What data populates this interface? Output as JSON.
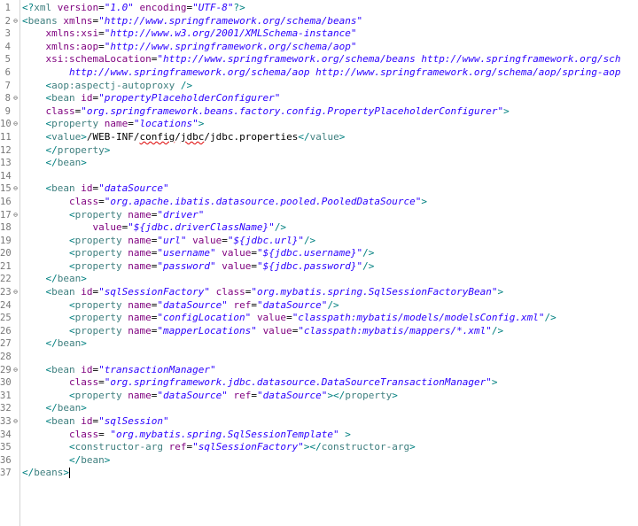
{
  "lines": [
    {
      "n": "1",
      "fold": "",
      "tokens": [
        [
          "pun",
          "<?"
        ],
        [
          "tag",
          "xml"
        ],
        [
          "txt",
          " "
        ],
        [
          "attr",
          "version"
        ],
        [
          "txt",
          "="
        ],
        [
          "val",
          "\"1.0\""
        ],
        [
          "txt",
          " "
        ],
        [
          "attr",
          "encoding"
        ],
        [
          "txt",
          "="
        ],
        [
          "val",
          "\"UTF-8\""
        ],
        [
          "pun",
          "?>"
        ]
      ]
    },
    {
      "n": "2",
      "fold": "⊖",
      "tokens": [
        [
          "pun",
          "<"
        ],
        [
          "tag",
          "beans"
        ],
        [
          "txt",
          " "
        ],
        [
          "attr",
          "xmlns"
        ],
        [
          "txt",
          "="
        ],
        [
          "val",
          "\"http://www.springframework.org/schema/beans\""
        ]
      ]
    },
    {
      "n": "3",
      "fold": "",
      "tokens": [
        [
          "txt",
          "    "
        ],
        [
          "attr",
          "xmlns:xsi"
        ],
        [
          "txt",
          "="
        ],
        [
          "val",
          "\"http://www.w3.org/2001/XMLSchema-instance\""
        ]
      ]
    },
    {
      "n": "4",
      "fold": "",
      "tokens": [
        [
          "txt",
          "    "
        ],
        [
          "attr",
          "xmlns:aop"
        ],
        [
          "txt",
          "="
        ],
        [
          "val",
          "\"http://www.springframework.org/schema/aop\""
        ]
      ]
    },
    {
      "n": "5",
      "fold": "",
      "tokens": [
        [
          "txt",
          "    "
        ],
        [
          "attr",
          "xsi:schemaLocation"
        ],
        [
          "txt",
          "="
        ],
        [
          "val",
          "\"http://www.springframework.org/schema/beans http://www.springframework.org/sch"
        ]
      ]
    },
    {
      "n": "6",
      "fold": "",
      "tokens": [
        [
          "val",
          "        http://www.springframework.org/schema/aop http://www.springframework.org/schema/aop/spring-aop"
        ]
      ]
    },
    {
      "n": "7",
      "fold": "",
      "tokens": [
        [
          "txt",
          "    "
        ],
        [
          "pun",
          "<"
        ],
        [
          "tag",
          "aop:aspectj-autoproxy"
        ],
        [
          "txt",
          " "
        ],
        [
          "pun",
          "/>"
        ]
      ]
    },
    {
      "n": "8",
      "fold": "⊖",
      "tokens": [
        [
          "txt",
          "    "
        ],
        [
          "pun",
          "<"
        ],
        [
          "tag",
          "bean"
        ],
        [
          "txt",
          " "
        ],
        [
          "attr",
          "id"
        ],
        [
          "txt",
          "="
        ],
        [
          "val",
          "\"propertyPlaceholderConfigurer\""
        ]
      ]
    },
    {
      "n": "9",
      "fold": "",
      "tokens": [
        [
          "txt",
          "    "
        ],
        [
          "attr",
          "class"
        ],
        [
          "txt",
          "="
        ],
        [
          "val",
          "\"org.springframework.beans.factory.config.PropertyPlaceholderConfigurer\""
        ],
        [
          "pun",
          ">"
        ]
      ]
    },
    {
      "n": "10",
      "fold": "⊖",
      "tokens": [
        [
          "txt",
          "    "
        ],
        [
          "pun",
          "<"
        ],
        [
          "tag",
          "property"
        ],
        [
          "txt",
          " "
        ],
        [
          "attr",
          "name"
        ],
        [
          "txt",
          "="
        ],
        [
          "val",
          "\"locations\""
        ],
        [
          "pun",
          ">"
        ]
      ]
    },
    {
      "n": "11",
      "fold": "",
      "tokens": [
        [
          "txt",
          "    "
        ],
        [
          "pun",
          "<"
        ],
        [
          "tag",
          "value"
        ],
        [
          "pun",
          ">"
        ],
        [
          "txt",
          "/WEB-INF/"
        ],
        [
          "sq",
          "config"
        ],
        [
          "txt",
          "/"
        ],
        [
          "sq",
          "jdbc"
        ],
        [
          "txt",
          "/jdbc.properties"
        ],
        [
          "pun",
          "</"
        ],
        [
          "tag",
          "value"
        ],
        [
          "pun",
          ">"
        ]
      ]
    },
    {
      "n": "12",
      "fold": "",
      "tokens": [
        [
          "txt",
          "    "
        ],
        [
          "pun",
          "</"
        ],
        [
          "tag",
          "property"
        ],
        [
          "pun",
          ">"
        ]
      ]
    },
    {
      "n": "13",
      "fold": "",
      "tokens": [
        [
          "txt",
          "    "
        ],
        [
          "pun",
          "</"
        ],
        [
          "tag",
          "bean"
        ],
        [
          "pun",
          ">"
        ]
      ]
    },
    {
      "n": "14",
      "fold": "",
      "tokens": []
    },
    {
      "n": "15",
      "fold": "⊖",
      "tokens": [
        [
          "txt",
          "    "
        ],
        [
          "pun",
          "<"
        ],
        [
          "tag",
          "bean"
        ],
        [
          "txt",
          " "
        ],
        [
          "attr",
          "id"
        ],
        [
          "txt",
          "="
        ],
        [
          "val",
          "\"dataSource\""
        ]
      ]
    },
    {
      "n": "16",
      "fold": "",
      "tokens": [
        [
          "txt",
          "        "
        ],
        [
          "attr",
          "class"
        ],
        [
          "txt",
          "="
        ],
        [
          "val",
          "\"org.apache.ibatis.datasource.pooled.PooledDataSource\""
        ],
        [
          "pun",
          ">"
        ]
      ]
    },
    {
      "n": "17",
      "fold": "⊖",
      "tokens": [
        [
          "txt",
          "        "
        ],
        [
          "pun",
          "<"
        ],
        [
          "tag",
          "property"
        ],
        [
          "txt",
          " "
        ],
        [
          "attr",
          "name"
        ],
        [
          "txt",
          "="
        ],
        [
          "val",
          "\"driver\""
        ]
      ]
    },
    {
      "n": "18",
      "fold": "",
      "tokens": [
        [
          "txt",
          "            "
        ],
        [
          "attr",
          "value"
        ],
        [
          "txt",
          "="
        ],
        [
          "val",
          "\"${jdbc.driverClassName}\""
        ],
        [
          "pun",
          "/>"
        ]
      ]
    },
    {
      "n": "19",
      "fold": "",
      "tokens": [
        [
          "txt",
          "        "
        ],
        [
          "pun",
          "<"
        ],
        [
          "tag",
          "property"
        ],
        [
          "txt",
          " "
        ],
        [
          "attr",
          "name"
        ],
        [
          "txt",
          "="
        ],
        [
          "val",
          "\"url\""
        ],
        [
          "txt",
          " "
        ],
        [
          "attr",
          "value"
        ],
        [
          "txt",
          "="
        ],
        [
          "val",
          "\"${jdbc.url}\""
        ],
        [
          "pun",
          "/>"
        ]
      ]
    },
    {
      "n": "20",
      "fold": "",
      "tokens": [
        [
          "txt",
          "        "
        ],
        [
          "pun",
          "<"
        ],
        [
          "tag",
          "property"
        ],
        [
          "txt",
          " "
        ],
        [
          "attr",
          "name"
        ],
        [
          "txt",
          "="
        ],
        [
          "val",
          "\"username\""
        ],
        [
          "txt",
          " "
        ],
        [
          "attr",
          "value"
        ],
        [
          "txt",
          "="
        ],
        [
          "val",
          "\"${jdbc.username}\""
        ],
        [
          "pun",
          "/>"
        ]
      ]
    },
    {
      "n": "21",
      "fold": "",
      "tokens": [
        [
          "txt",
          "        "
        ],
        [
          "pun",
          "<"
        ],
        [
          "tag",
          "property"
        ],
        [
          "txt",
          " "
        ],
        [
          "attr",
          "name"
        ],
        [
          "txt",
          "="
        ],
        [
          "val",
          "\"password\""
        ],
        [
          "txt",
          " "
        ],
        [
          "attr",
          "value"
        ],
        [
          "txt",
          "="
        ],
        [
          "val",
          "\"${jdbc.password}\""
        ],
        [
          "pun",
          "/>"
        ]
      ]
    },
    {
      "n": "22",
      "fold": "",
      "tokens": [
        [
          "txt",
          "    "
        ],
        [
          "pun",
          "</"
        ],
        [
          "tag",
          "bean"
        ],
        [
          "pun",
          ">"
        ]
      ]
    },
    {
      "n": "23",
      "fold": "⊖",
      "tokens": [
        [
          "txt",
          "    "
        ],
        [
          "pun",
          "<"
        ],
        [
          "tag",
          "bean"
        ],
        [
          "txt",
          " "
        ],
        [
          "attr",
          "id"
        ],
        [
          "txt",
          "="
        ],
        [
          "val",
          "\"sqlSessionFactory\""
        ],
        [
          "txt",
          " "
        ],
        [
          "attr",
          "class"
        ],
        [
          "txt",
          "="
        ],
        [
          "val",
          "\"org.mybatis.spring.SqlSessionFactoryBean\""
        ],
        [
          "pun",
          ">"
        ]
      ]
    },
    {
      "n": "24",
      "fold": "",
      "tokens": [
        [
          "txt",
          "        "
        ],
        [
          "pun",
          "<"
        ],
        [
          "tag",
          "property"
        ],
        [
          "txt",
          " "
        ],
        [
          "attr",
          "name"
        ],
        [
          "txt",
          "="
        ],
        [
          "val",
          "\"dataSource\""
        ],
        [
          "txt",
          " "
        ],
        [
          "attr",
          "ref"
        ],
        [
          "txt",
          "="
        ],
        [
          "val",
          "\"dataSource\""
        ],
        [
          "pun",
          "/>"
        ]
      ]
    },
    {
      "n": "25",
      "fold": "",
      "tokens": [
        [
          "txt",
          "        "
        ],
        [
          "pun",
          "<"
        ],
        [
          "tag",
          "property"
        ],
        [
          "txt",
          " "
        ],
        [
          "attr",
          "name"
        ],
        [
          "txt",
          "="
        ],
        [
          "val",
          "\"configLocation\""
        ],
        [
          "txt",
          " "
        ],
        [
          "attr",
          "value"
        ],
        [
          "txt",
          "="
        ],
        [
          "val",
          "\"classpath:mybatis/models/modelsConfig.xml\""
        ],
        [
          "pun",
          "/>"
        ]
      ]
    },
    {
      "n": "26",
      "fold": "",
      "tokens": [
        [
          "txt",
          "        "
        ],
        [
          "pun",
          "<"
        ],
        [
          "tag",
          "property"
        ],
        [
          "txt",
          " "
        ],
        [
          "attr",
          "name"
        ],
        [
          "txt",
          "="
        ],
        [
          "val",
          "\"mapperLocations\""
        ],
        [
          "txt",
          " "
        ],
        [
          "attr",
          "value"
        ],
        [
          "txt",
          "="
        ],
        [
          "val",
          "\"classpath:mybatis/mappers/*.xml\""
        ],
        [
          "pun",
          "/>"
        ]
      ]
    },
    {
      "n": "27",
      "fold": "",
      "tokens": [
        [
          "txt",
          "    "
        ],
        [
          "pun",
          "</"
        ],
        [
          "tag",
          "bean"
        ],
        [
          "pun",
          ">"
        ]
      ]
    },
    {
      "n": "28",
      "fold": "",
      "tokens": []
    },
    {
      "n": "29",
      "fold": "⊖",
      "tokens": [
        [
          "txt",
          "    "
        ],
        [
          "pun",
          "<"
        ],
        [
          "tag",
          "bean"
        ],
        [
          "txt",
          " "
        ],
        [
          "attr",
          "id"
        ],
        [
          "txt",
          "="
        ],
        [
          "val",
          "\"transactionManager\""
        ]
      ]
    },
    {
      "n": "30",
      "fold": "",
      "tokens": [
        [
          "txt",
          "        "
        ],
        [
          "attr",
          "class"
        ],
        [
          "txt",
          "="
        ],
        [
          "val",
          "\"org.springframework.jdbc.datasource.DataSourceTransactionManager\""
        ],
        [
          "pun",
          ">"
        ]
      ]
    },
    {
      "n": "31",
      "fold": "",
      "tokens": [
        [
          "txt",
          "        "
        ],
        [
          "pun",
          "<"
        ],
        [
          "tag",
          "property"
        ],
        [
          "txt",
          " "
        ],
        [
          "attr",
          "name"
        ],
        [
          "txt",
          "="
        ],
        [
          "val",
          "\"dataSource\""
        ],
        [
          "txt",
          " "
        ],
        [
          "attr",
          "ref"
        ],
        [
          "txt",
          "="
        ],
        [
          "val",
          "\"dataSource\""
        ],
        [
          "pun",
          "></"
        ],
        [
          "tag",
          "property"
        ],
        [
          "pun",
          ">"
        ]
      ]
    },
    {
      "n": "32",
      "fold": "",
      "tokens": [
        [
          "txt",
          "    "
        ],
        [
          "pun",
          "</"
        ],
        [
          "tag",
          "bean"
        ],
        [
          "pun",
          ">"
        ]
      ]
    },
    {
      "n": "33",
      "fold": "⊖",
      "tokens": [
        [
          "txt",
          "    "
        ],
        [
          "pun",
          "<"
        ],
        [
          "tag",
          "bean"
        ],
        [
          "txt",
          " "
        ],
        [
          "attr",
          "id"
        ],
        [
          "txt",
          "="
        ],
        [
          "val",
          "\"sqlSession\""
        ]
      ]
    },
    {
      "n": "34",
      "fold": "",
      "tokens": [
        [
          "txt",
          "        "
        ],
        [
          "attr",
          "class"
        ],
        [
          "txt",
          "= "
        ],
        [
          "val",
          "\"org.mybatis.spring.SqlSessionTemplate\""
        ],
        [
          "txt",
          " "
        ],
        [
          "pun",
          ">"
        ]
      ]
    },
    {
      "n": "35",
      "fold": "",
      "tokens": [
        [
          "txt",
          "        "
        ],
        [
          "pun",
          "<"
        ],
        [
          "tag",
          "constructor-arg"
        ],
        [
          "txt",
          " "
        ],
        [
          "attr",
          "ref"
        ],
        [
          "txt",
          "="
        ],
        [
          "val",
          "\"sqlSessionFactory\""
        ],
        [
          "pun",
          "></"
        ],
        [
          "tag",
          "constructor-arg"
        ],
        [
          "pun",
          ">"
        ]
      ]
    },
    {
      "n": "36",
      "fold": "",
      "tokens": [
        [
          "txt",
          "        "
        ],
        [
          "pun",
          "</"
        ],
        [
          "tag",
          "bean"
        ],
        [
          "pun",
          ">"
        ]
      ]
    },
    {
      "n": "37",
      "fold": "",
      "tokens": [
        [
          "pun",
          "</"
        ],
        [
          "tag",
          "beans"
        ],
        [
          "pun",
          ">"
        ],
        [
          "caret",
          ""
        ]
      ]
    }
  ]
}
